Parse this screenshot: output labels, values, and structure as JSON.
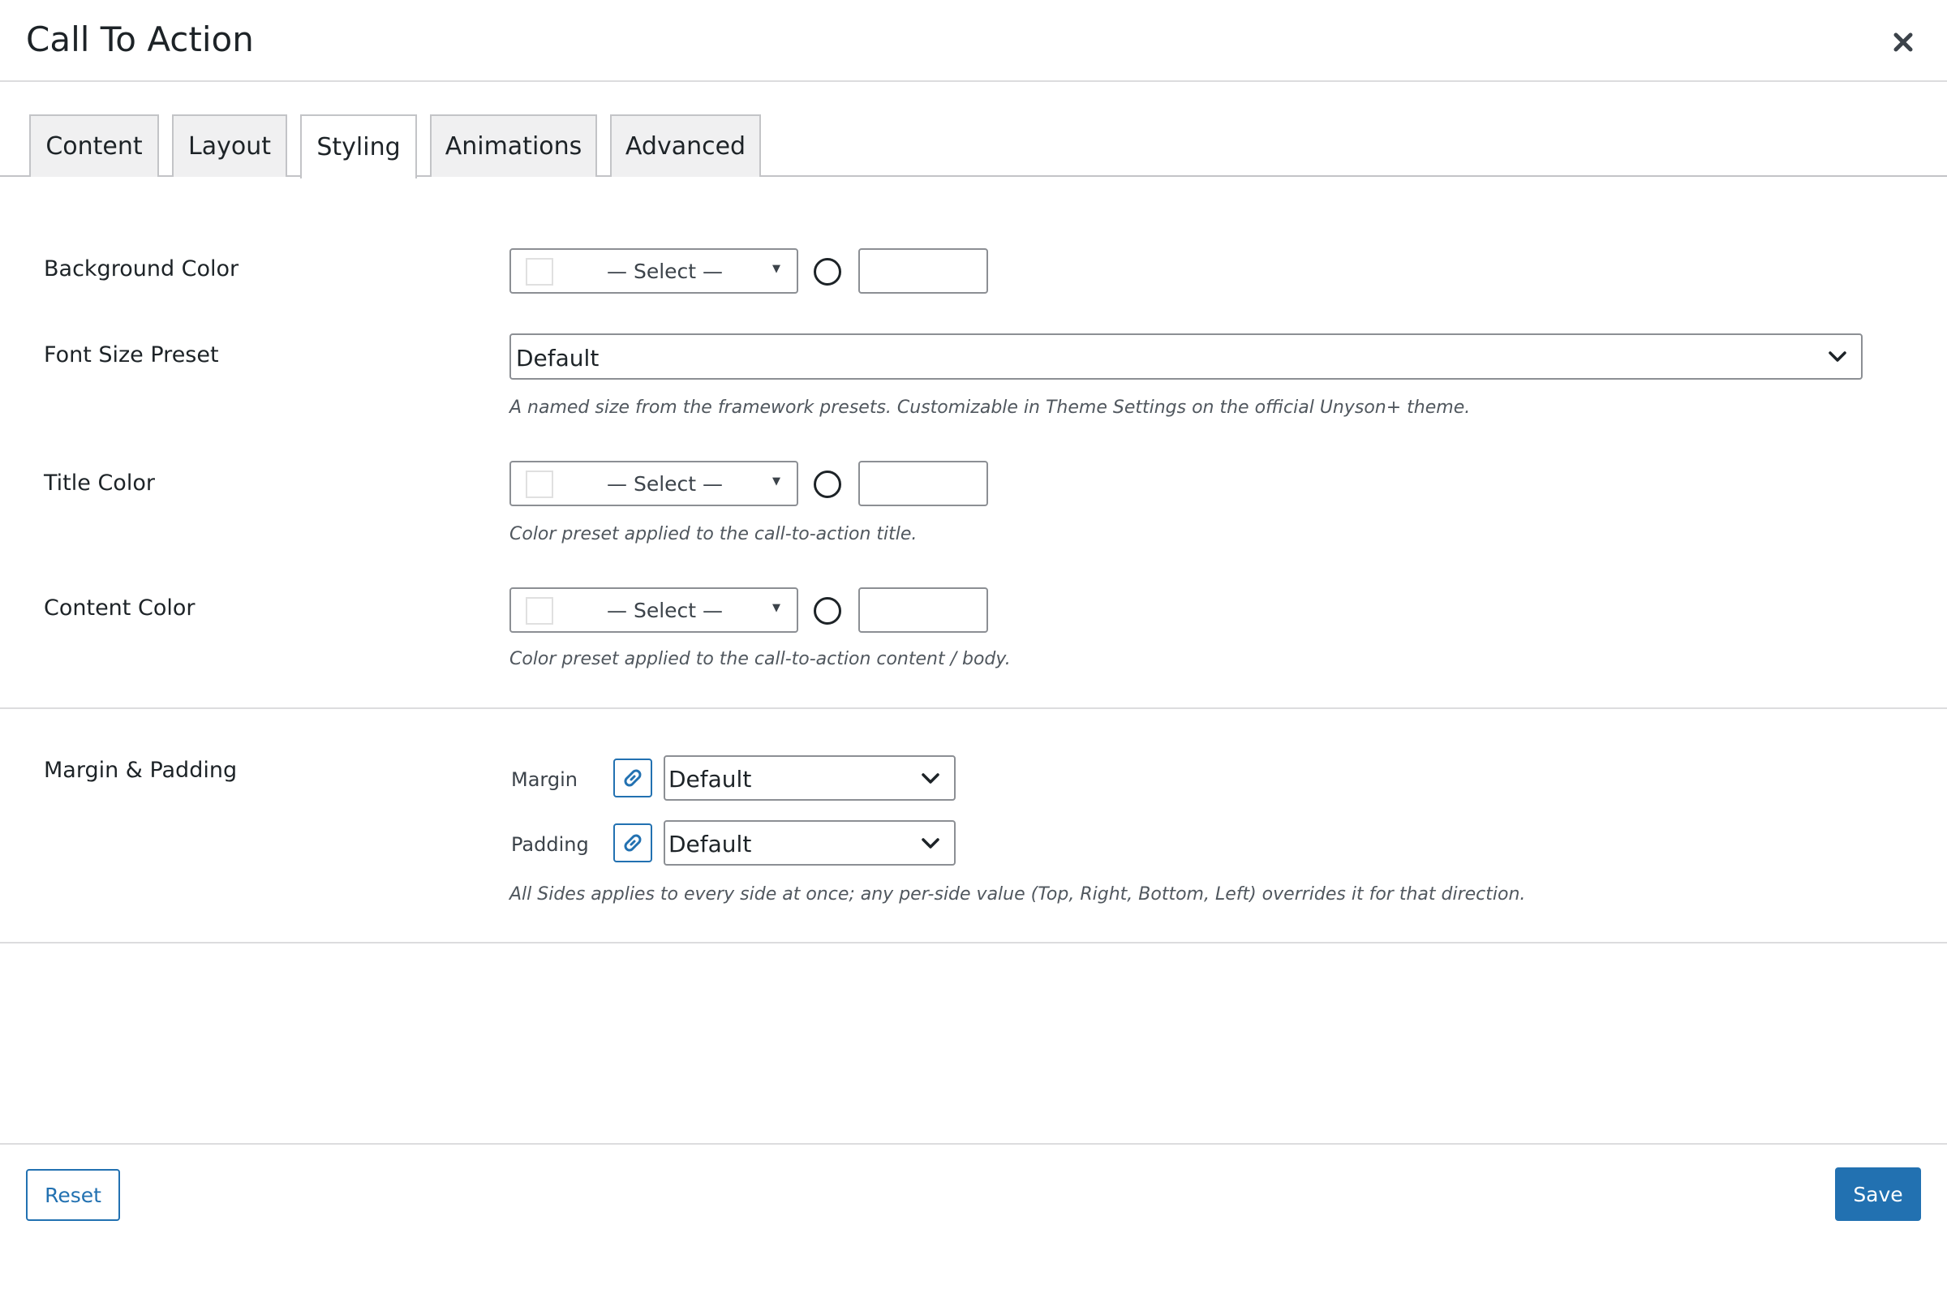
{
  "modal": {
    "title": "Call To Action",
    "close_icon": "close-icon"
  },
  "tabs": [
    {
      "label": "Content",
      "active": false
    },
    {
      "label": "Layout",
      "active": false
    },
    {
      "label": "Styling",
      "active": true
    },
    {
      "label": "Animations",
      "active": false
    },
    {
      "label": "Advanced",
      "active": false
    }
  ],
  "styling": {
    "background_color": {
      "label": "Background Color",
      "select_text": "— Select —",
      "custom_value": ""
    },
    "font_size_preset": {
      "label": "Font Size Preset",
      "value": "Default",
      "help": "A named size from the framework presets. Customizable in Theme Settings on the official Unyson+ theme."
    },
    "title_color": {
      "label": "Title Color",
      "select_text": "— Select —",
      "custom_value": "",
      "help": "Color preset applied to the call-to-action title."
    },
    "content_color": {
      "label": "Content Color",
      "select_text": "— Select —",
      "custom_value": "",
      "help": "Color preset applied to the call-to-action content / body."
    },
    "margin_padding": {
      "label": "Margin & Padding",
      "margin_label": "Margin",
      "margin_value": "Default",
      "padding_label": "Padding",
      "padding_value": "Default",
      "help": "All Sides applies to every side at once; any per-side value (Top, Right, Bottom, Left) overrides it for that direction."
    }
  },
  "footer": {
    "reset_label": "Reset",
    "save_label": "Save"
  },
  "colors": {
    "accent": "#2271b1",
    "border": "#8c8f94",
    "text": "#1d2327",
    "help_text": "#50575e",
    "tab_bg": "#f0f0f1"
  }
}
